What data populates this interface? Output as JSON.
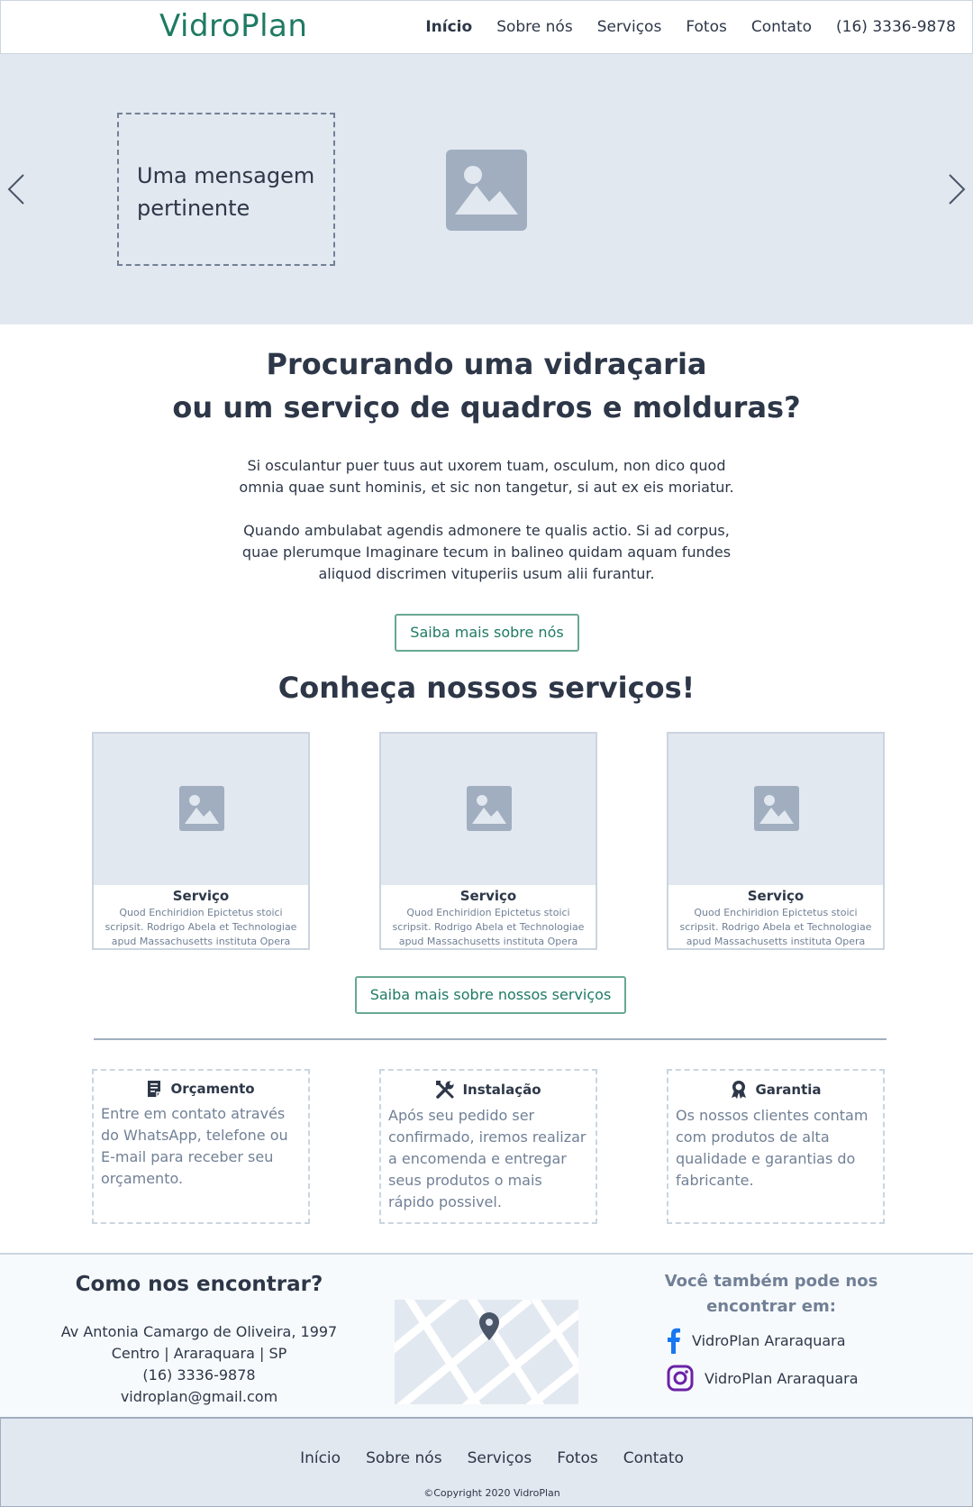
{
  "header": {
    "logo": "VidroPlan",
    "nav": [
      "Início",
      "Sobre nós",
      "Serviços",
      "Fotos",
      "Contato"
    ],
    "phone": "(16) 3336-9878"
  },
  "hero": {
    "message_line1": "Uma mensagem",
    "message_line2": "pertinente",
    "image_icon": "image-placeholder-icon",
    "prev_icon": "chevron-left-icon",
    "next_icon": "chevron-right-icon"
  },
  "intro": {
    "title_line1": "Procurando uma vidraçaria",
    "title_line2": "ou um serviço de quadros e molduras?",
    "paragraph1_line1": "Si osculantur puer tuus aut uxorem tuam, osculum, non dico quod",
    "paragraph1_line2": "omnia quae sunt hominis, et sic non tangetur, si aut ex eis moriatur.",
    "paragraph2_line1": "Quando ambulabat agendis admonere te qualis actio. Si ad corpus,",
    "paragraph2_line2": "quae plerumque Imaginare tecum in balineo quidam aquam fundes",
    "paragraph2_line3": "aliquod discrimen vituperiis usum alii furantur.",
    "button": "Saiba mais sobre nós"
  },
  "services": {
    "title": "Conheça nossos serviços!",
    "cards": [
      {
        "title": "Serviço",
        "line1": "Quod Enchiridion Epictetus stoici",
        "line2": "scripsit. Rodrigo Abela et Technologiae",
        "line3": "apud Massachusetts instituta Opera"
      },
      {
        "title": "Serviço",
        "line1": "Quod Enchiridion Epictetus stoici",
        "line2": "scripsit. Rodrigo Abela et Technologiae",
        "line3": "apud Massachusetts instituta Opera"
      },
      {
        "title": "Serviço",
        "line1": "Quod Enchiridion Epictetus stoici",
        "line2": "scripsit. Rodrigo Abela et Technologiae",
        "line3": "apud Massachusetts instituta Opera"
      }
    ],
    "button": "Saiba mais sobre nossos serviços"
  },
  "features": [
    {
      "icon": "document-icon",
      "title": "Orçamento",
      "text": "Entre em contato através do WhatsApp, telefone ou E-mail para receber seu orçamento."
    },
    {
      "icon": "tools-icon",
      "title": "Instalação",
      "text": "Após seu pedido ser confirmado, iremos realizar a encomenda e entregar seus produtos o mais rápido possivel."
    },
    {
      "icon": "award-icon",
      "title": "Garantia",
      "text": "Os nossos clientes contam com produtos de alta qualidade e garantias do fabricante."
    }
  ],
  "find": {
    "title": "Como nos encontrar?",
    "address_line1": "Av Antonia Camargo de Oliveira, 1997",
    "address_line2": "Centro | Araraquara | SP",
    "phone": "(16) 3336-9878",
    "email": "vidroplan@gmail.com",
    "social_title_line1": "Você também pode nos",
    "social_title_line2": "encontrar em:",
    "facebook": "VidroPlan Araraquara",
    "instagram": "VidroPlan Araraquara"
  },
  "footer": {
    "nav": [
      "Início",
      "Sobre nós",
      "Serviços",
      "Fotos",
      "Contato"
    ],
    "copyright": "©Copyright 2020 VidroPlan"
  },
  "colors": {
    "brand": "#1f7a63",
    "hero_bg": "#e2e8f0",
    "facebook": "#1877f2",
    "instagram": "#6b21a8"
  }
}
